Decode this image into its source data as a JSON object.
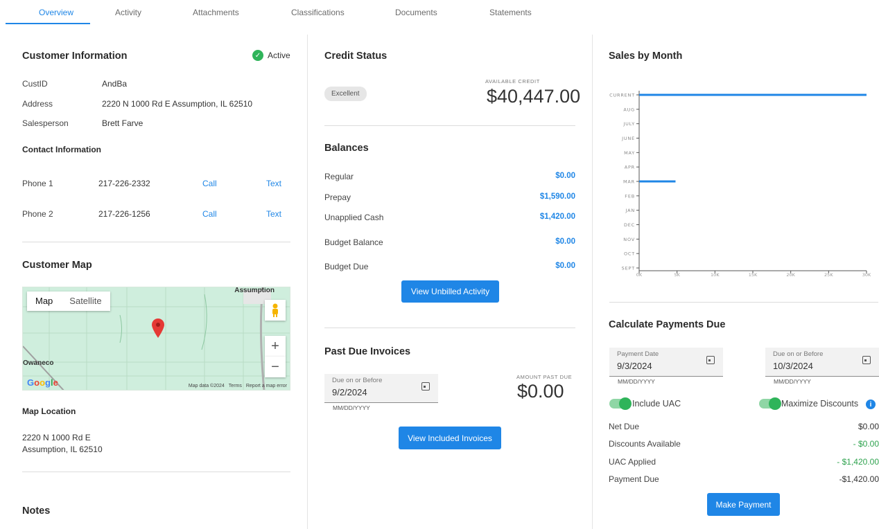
{
  "tabs": [
    {
      "label": "Overview",
      "active": true
    },
    {
      "label": "Activity"
    },
    {
      "label": "Attachments"
    },
    {
      "label": "Classifications"
    },
    {
      "label": "Documents"
    },
    {
      "label": "Statements"
    }
  ],
  "customer": {
    "title": "Customer Information",
    "status": "Active",
    "fields": [
      {
        "label": "CustID",
        "value": "AndBa"
      },
      {
        "label": "Address",
        "value": "2220 N 1000 Rd E Assumption, IL 62510"
      },
      {
        "label": "Salesperson",
        "value": "Brett Farve"
      }
    ],
    "contact_title": "Contact Information",
    "phones": [
      {
        "label": "Phone 1",
        "number": "217-226-2332",
        "call": "Call",
        "text": "Text"
      },
      {
        "label": "Phone 2",
        "number": "217-226-1256",
        "call": "Call",
        "text": "Text"
      }
    ]
  },
  "map": {
    "title": "Customer Map",
    "tab_map": "Map",
    "tab_satellite": "Satellite",
    "town_1": "Assumption",
    "town_2": "Owaneco",
    "logo": "Google",
    "data_text": "Map data ©2024",
    "terms": "Terms",
    "report": "Report a map error",
    "location_title": "Map Location",
    "location_line1": "2220 N 1000 Rd E",
    "location_line2": "Assumption, IL 62510"
  },
  "notes": {
    "title": "Notes"
  },
  "credit": {
    "title": "Credit Status",
    "rating": "Excellent",
    "available_label": "AVAILABLE CREDIT",
    "available_value": "$40,447.00"
  },
  "balances": {
    "title": "Balances",
    "rows": [
      {
        "label": "Regular",
        "value": "$0.00"
      },
      {
        "label": "Prepay",
        "value": "$1,590.00"
      },
      {
        "label": "Unapplied Cash",
        "value": "$1,420.00"
      },
      {
        "label": "Budget Balance",
        "value": "$0.00"
      },
      {
        "label": "Budget Due",
        "value": "$0.00"
      }
    ],
    "button": "View Unbilled Activity"
  },
  "past_due": {
    "title": "Past Due Invoices",
    "date_label": "Due on or Before",
    "date_value": "9/2/2024",
    "date_hint": "MM/DD/YYYY",
    "amount_label": "AMOUNT PAST DUE",
    "amount_value": "$0.00",
    "button": "View Included Invoices"
  },
  "sales": {
    "title": "Sales by Month"
  },
  "chart_data": {
    "type": "bar",
    "orientation": "horizontal",
    "title": "Sales by Month",
    "categories": [
      "CURRENT",
      "AUG",
      "JULY",
      "JUNE",
      "MAY",
      "APR",
      "MAR",
      "FEB",
      "JAN",
      "DEC",
      "NOV",
      "OCT",
      "SEPT"
    ],
    "values": [
      30000,
      0,
      0,
      0,
      0,
      0,
      4800,
      0,
      0,
      0,
      0,
      0,
      0
    ],
    "xticks": [
      "0K",
      "5K",
      "10K",
      "15K",
      "20K",
      "25K",
      "30K"
    ],
    "xlim": [
      0,
      30000
    ],
    "color": "#1f86e6"
  },
  "payments": {
    "title": "Calculate Payments Due",
    "payment_date_label": "Payment Date",
    "payment_date_value": "9/3/2024",
    "due_label": "Due on or Before",
    "due_value": "10/3/2024",
    "hint": "MM/DD/YYYY",
    "include_uac": "Include UAC",
    "max_discounts": "Maximize Discounts",
    "rows": [
      {
        "label": "Net Due",
        "value": "$0.00",
        "color": "#333333"
      },
      {
        "label": "Discounts Available",
        "value": "- $0.00",
        "color": "#2fa34f"
      },
      {
        "label": "UAC Applied",
        "value": "- $1,420.00",
        "color": "#2fa34f"
      },
      {
        "label": "Payment Due",
        "value": "-$1,420.00",
        "color": "#333333"
      }
    ],
    "button": "Make Payment"
  },
  "colors": {
    "accent": "#1f86e6",
    "success": "#2fb45a"
  }
}
